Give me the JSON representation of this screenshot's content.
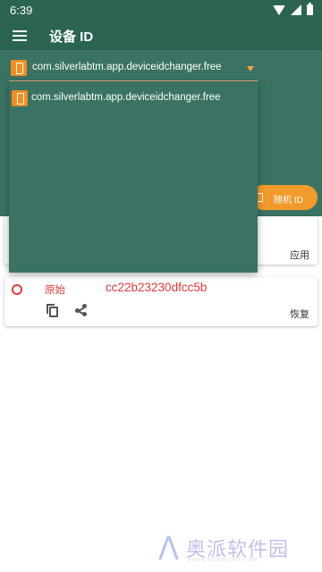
{
  "status_bar": {
    "time": "6:39",
    "icons": [
      "wifi-icon",
      "signal-icon",
      "battery-icon"
    ]
  },
  "app_bar": {
    "title": "设备 ID",
    "menu_icon": "menu-icon"
  },
  "app_selector": {
    "selected": "com.silverlabtm.app.deviceidchanger.free"
  },
  "dropdown": {
    "items": [
      {
        "label": "com.silverlabtm.app.deviceidchanger.free"
      }
    ]
  },
  "random_button": {
    "label": "随机 ID"
  },
  "apply_card": {
    "apply_label": "应用"
  },
  "original_card": {
    "label": "原始",
    "value": "cc22b23230dfcc5b",
    "restore_label": "恢复"
  },
  "watermark": {
    "text": "奥派软件园",
    "sub": "AOPAIRUANJIAN.COM"
  },
  "colors": {
    "primary": "#2b6453",
    "panel": "#3a7363",
    "accent": "#f39a2c",
    "error": "#e53935"
  }
}
